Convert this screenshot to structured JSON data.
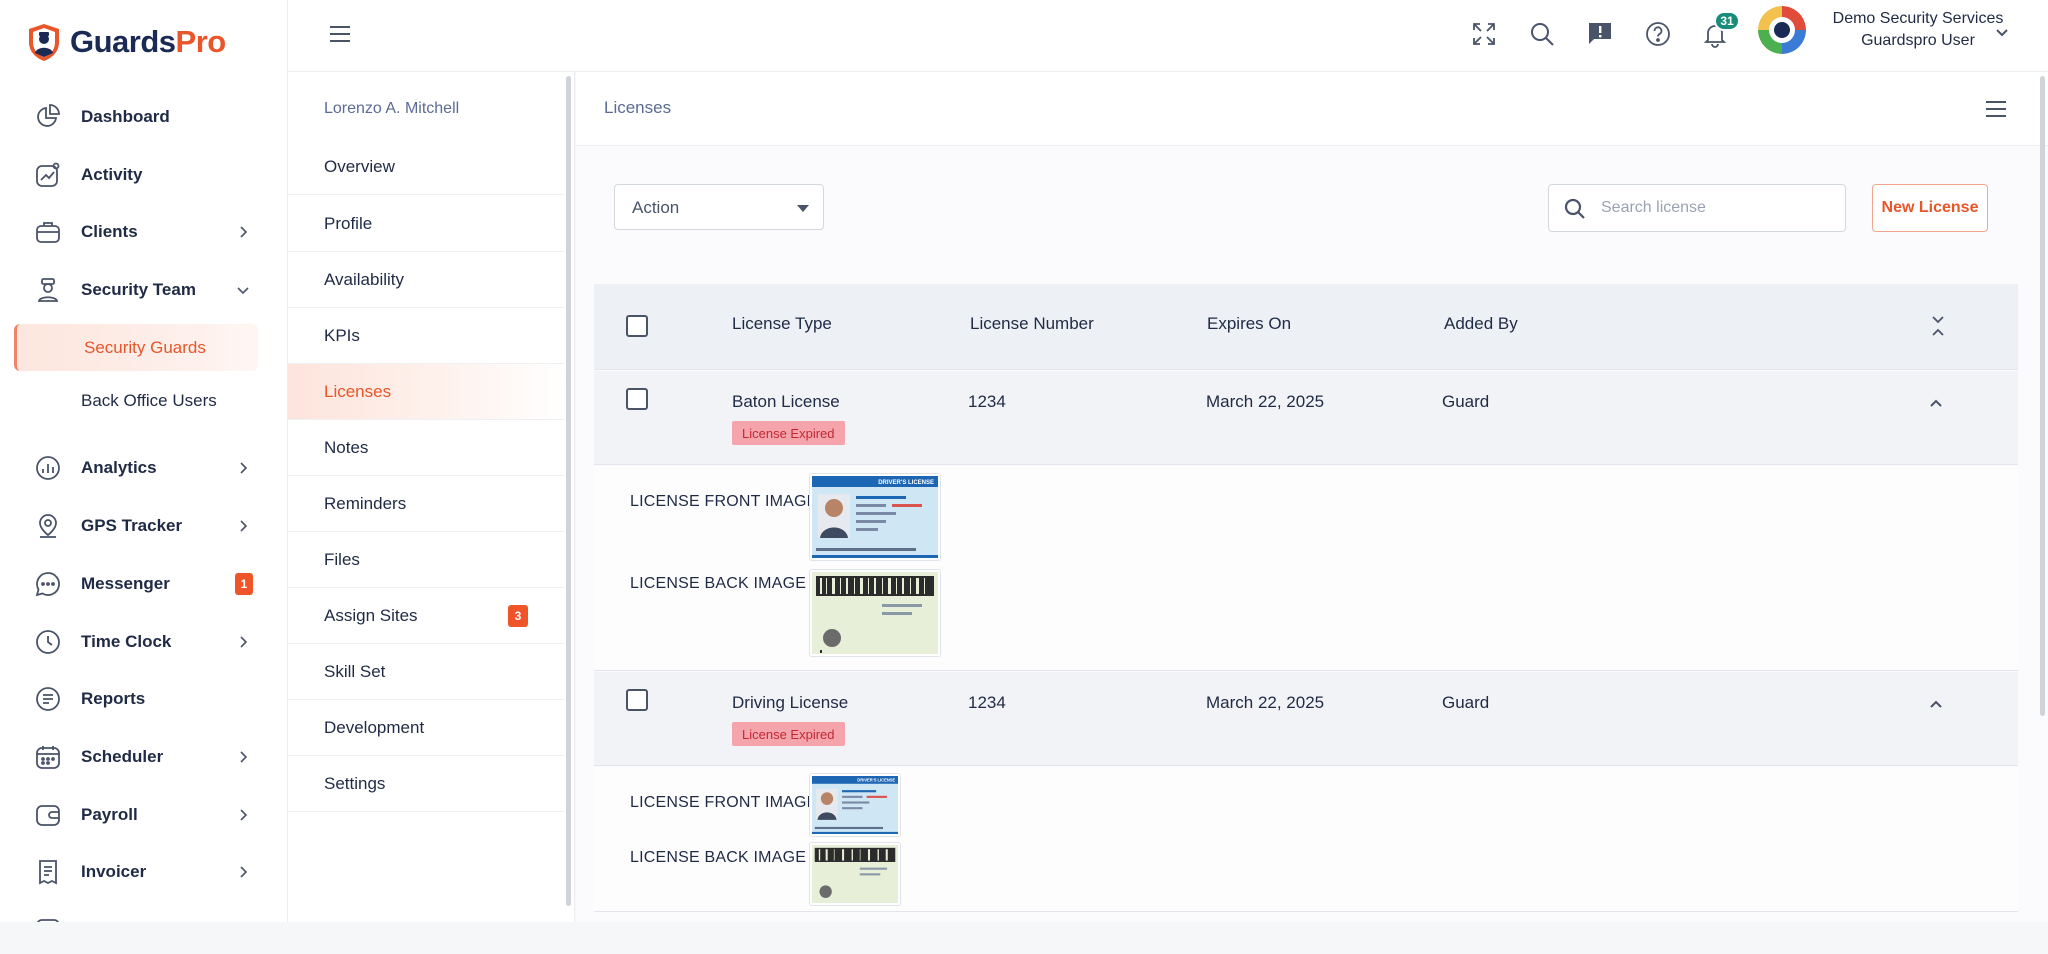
{
  "brand": {
    "name_part1": "Guards",
    "name_part2": "Pro",
    "primary": "#1b2a55",
    "accent": "#e8562a"
  },
  "sidebar": {
    "items": [
      {
        "label": "Dashboard",
        "icon": "pie-chart-icon",
        "chevron": false
      },
      {
        "label": "Activity",
        "icon": "activity-chart-icon",
        "chevron": false
      },
      {
        "label": "Clients",
        "icon": "briefcase-icon",
        "chevron": true
      },
      {
        "label": "Security Team",
        "icon": "guard-icon",
        "chevron": "down"
      },
      {
        "label": "Security Guards",
        "sub": true,
        "active": true
      },
      {
        "label": "Back Office Users",
        "sub": true
      },
      {
        "label": "Analytics",
        "icon": "bar-chart-icon",
        "chevron": true
      },
      {
        "label": "GPS Tracker",
        "icon": "map-pin-icon",
        "chevron": true
      },
      {
        "label": "Messenger",
        "icon": "chat-icon",
        "badge": "1"
      },
      {
        "label": "Time Clock",
        "icon": "clock-icon",
        "chevron": true
      },
      {
        "label": "Reports",
        "icon": "report-icon",
        "chevron": false
      },
      {
        "label": "Scheduler",
        "icon": "calendar-icon",
        "chevron": true
      },
      {
        "label": "Payroll",
        "icon": "wallet-icon",
        "chevron": true
      },
      {
        "label": "Invoicer",
        "icon": "invoice-icon",
        "chevron": true
      }
    ]
  },
  "header": {
    "notifications_count": "31",
    "user_org": "Demo Security Services",
    "user_role": "Guardspro User",
    "icons": [
      "expand-icon",
      "search-icon",
      "feedback-icon",
      "help-icon",
      "bell-icon"
    ]
  },
  "subpanel": {
    "person_name": "Lorenzo A. Mitchell",
    "items": [
      {
        "label": "Overview"
      },
      {
        "label": "Profile"
      },
      {
        "label": "Availability"
      },
      {
        "label": "KPIs"
      },
      {
        "label": "Licenses",
        "active": true
      },
      {
        "label": "Notes"
      },
      {
        "label": "Reminders"
      },
      {
        "label": "Files"
      },
      {
        "label": "Assign Sites",
        "badge": "3"
      },
      {
        "label": "Skill Set"
      },
      {
        "label": "Development"
      },
      {
        "label": "Settings"
      }
    ]
  },
  "main": {
    "title": "Licenses",
    "action_label": "Action",
    "search_placeholder": "Search license",
    "new_button": "New License",
    "columns": [
      "License Type",
      "License Number",
      "Expires On",
      "Added By"
    ],
    "rows": [
      {
        "type": "Baton License",
        "number": "1234",
        "expires": "March 22, 2025",
        "added_by": "Guard",
        "status": "License Expired",
        "front_label": "LICENSE FRONT IMAGE",
        "back_label": "LICENSE BACK IMAGE",
        "card_title": "DRIVER'S LICENSE"
      },
      {
        "type": "Driving License",
        "number": "1234",
        "expires": "March 22, 2025",
        "added_by": "Guard",
        "status": "License Expired",
        "front_label": "LICENSE FRONT IMAGE",
        "back_label": "LICENSE BACK IMAGE",
        "card_title": "DRIVER'S LICENSE"
      }
    ]
  }
}
